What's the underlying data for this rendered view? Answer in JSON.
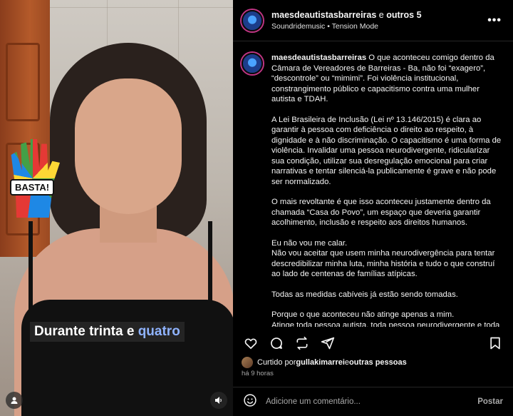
{
  "video": {
    "sticker_text": "BASTA!",
    "subtitle_main": "Durante trinta e ",
    "subtitle_accent": "quatro",
    "user_icon": "person-icon",
    "sound_icon": "speaker-icon"
  },
  "header": {
    "username": "maesdeautistasbarreiras",
    "connector": " e ",
    "others": "outros 5",
    "audio_artist": "Soundridemusic",
    "audio_separator": " • ",
    "audio_track": "Tension Mode",
    "more_icon": "more-options-icon"
  },
  "caption": {
    "username": "maesdeautistasbarreiras",
    "p1": " O que aconteceu comigo dentro da Câmara de Vereadores de Barreiras - Ba, não foi “exagero”, “descontrole” ou “mimimi”. Foi violência institucional, constrangimento público e capacitismo contra uma mulher autista e TDAH.",
    "p2": "A Lei Brasileira de Inclusão (Lei nº 13.146/2015) é clara ao garantir à pessoa com deficiência o direito ao respeito, à dignidade e à não discriminação. O capacitismo é uma forma de violência. Invalidar uma pessoa neurodivergente, ridicularizar sua condição, utilizar sua desregulação emocional para criar narrativas e tentar silenciá-la publicamente é grave e não pode ser normalizado.",
    "p3": "O mais revoltante é que isso aconteceu justamente dentro da chamada “Casa do Povo”, um espaço que deveria garantir acolhimento, inclusão e respeito aos direitos humanos.",
    "p4a": "Eu não vou me calar.",
    "p4b": "Não vou aceitar que usem minha neurodivergência para tentar descredibilizar minha luta, minha história e tudo o que construí ao lado de centenas de famílias atípicas.",
    "p5": "Todas as medidas cabíveis já estão sendo tomadas.",
    "p6a": "Porque o que aconteceu não atinge apenas a mim.",
    "p6b": "Atinge toda pessoa autista, toda pessoa neurodivergente e toda família que diariamente luta para ser respeitada em uma sociedade"
  },
  "actions": {
    "like_icon": "heart-icon",
    "comment_icon": "comment-icon",
    "repost_icon": "repost-icon",
    "share_icon": "share-icon",
    "save_icon": "bookmark-icon"
  },
  "likes": {
    "prefix": "Curtido por ",
    "user": "gullakimarrei",
    "connector": " e ",
    "others": "outras pessoas"
  },
  "time": "há 9 horas",
  "comment": {
    "emoji_icon": "emoji-icon",
    "placeholder": "Adicione um comentário...",
    "post_label": "Postar"
  }
}
